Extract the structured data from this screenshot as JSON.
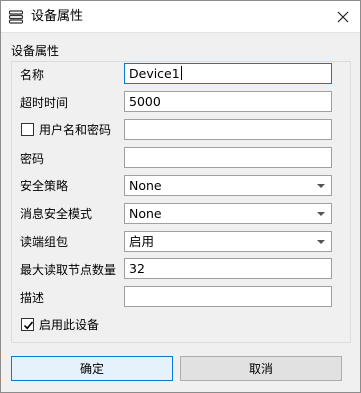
{
  "window": {
    "title": "设备属性",
    "title_icon": "list-icon",
    "close_icon": "close-icon"
  },
  "group": {
    "title": "设备属性"
  },
  "form": {
    "name_label": "名称",
    "name_value": "Device1",
    "timeout_label": "超时时间",
    "timeout_value": "5000",
    "userpass_label": "用户名和密码",
    "userpass_checked": false,
    "userpass_value": "",
    "password_label": "密码",
    "password_value": "",
    "security_policy_label": "安全策略",
    "security_policy_value": "None",
    "message_mode_label": "消息安全模式",
    "message_mode_value": "None",
    "read_group_label": "读端组包",
    "read_group_value": "启用",
    "max_read_label": "最大读取节点数量",
    "max_read_value": "32",
    "desc_label": "描述",
    "desc_value": "",
    "enable_label": "启用此设备",
    "enable_checked": true
  },
  "buttons": {
    "ok_label": "确定",
    "cancel_label": "取消"
  },
  "colors": {
    "accent": "#0a78d7",
    "window_bg": "#f0f0f0",
    "field_border": "#a0a0a0"
  }
}
